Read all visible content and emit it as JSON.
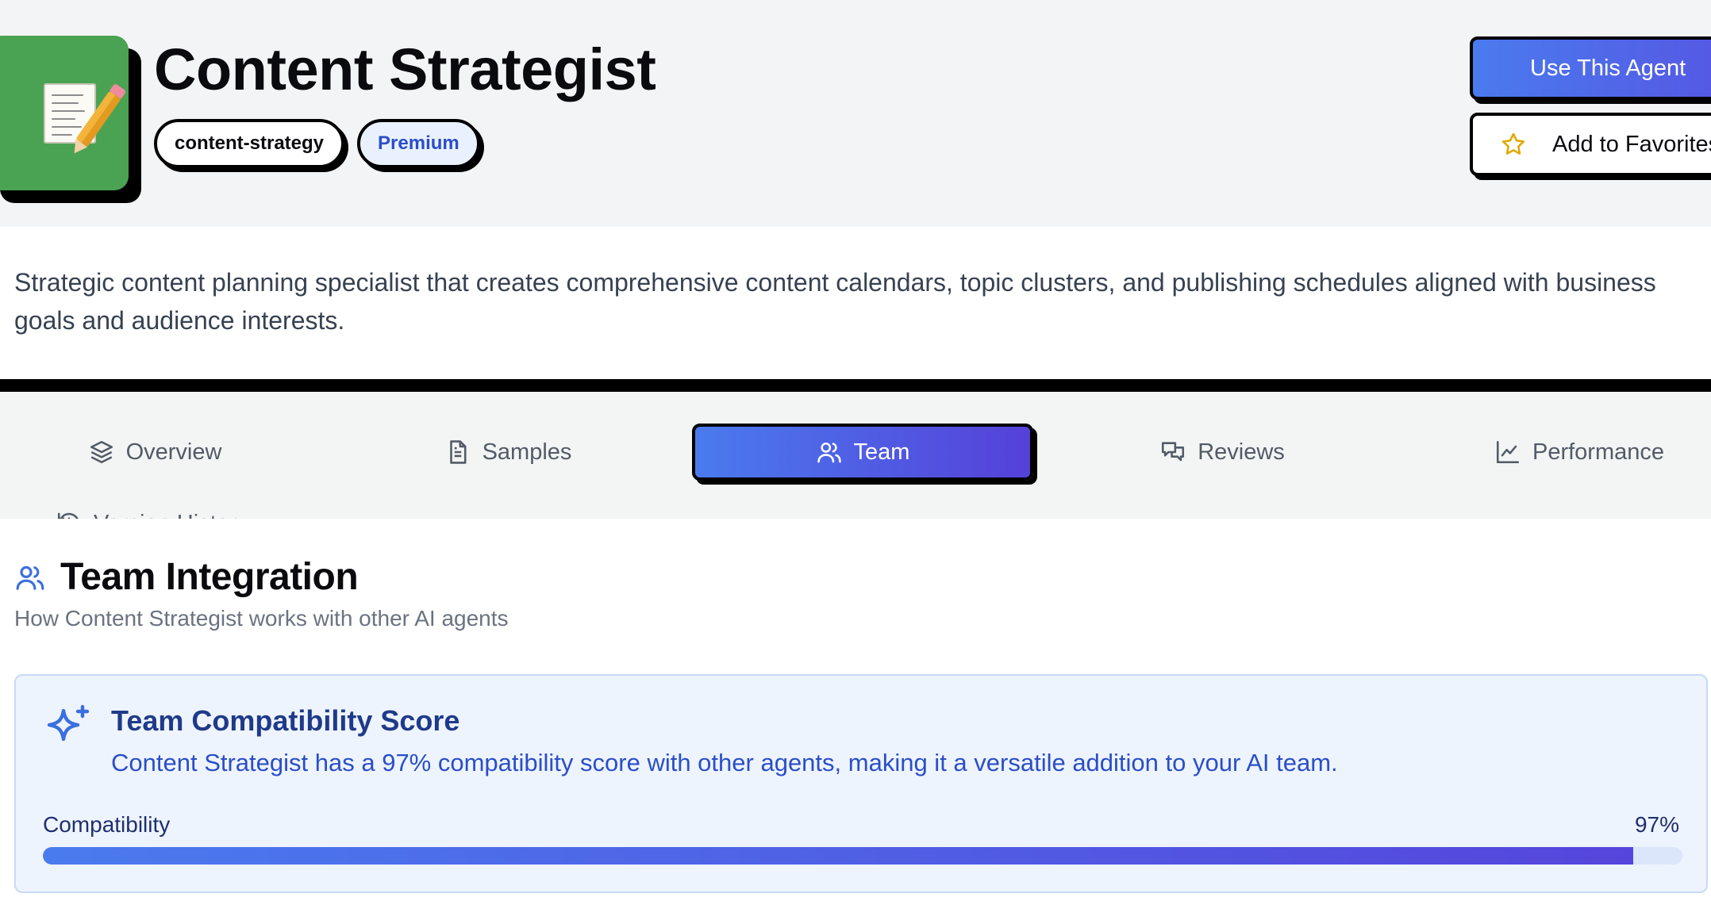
{
  "agent": {
    "title": "Content Strategist",
    "icon": "memo-pencil-icon",
    "icon_bg": "#4aa353",
    "tags": [
      "content-strategy",
      "Premium"
    ],
    "description": "Strategic content planning specialist that creates comprehensive content calendars, topic clusters, and publishing schedules aligned with business goals and audience interests."
  },
  "actions": {
    "use_label": "Use This Agent",
    "favorite_label": "Add to Favorites",
    "favorite_icon": "star-icon"
  },
  "tabs": [
    {
      "label": "Overview",
      "icon": "layers-icon",
      "active": false
    },
    {
      "label": "Samples",
      "icon": "document-icon",
      "active": false
    },
    {
      "label": "Team",
      "icon": "users-icon",
      "active": true
    },
    {
      "label": "Reviews",
      "icon": "chat-bubbles-icon",
      "active": false
    },
    {
      "label": "Performance",
      "icon": "line-chart-icon",
      "active": false
    },
    {
      "label": "Version History",
      "icon": "history-icon",
      "active": false
    }
  ],
  "team": {
    "title": "Team Integration",
    "subtitle": "How Content Strategist works with other AI agents",
    "compatibility": {
      "title": "Team Compatibility Score",
      "text": "Content Strategist has a 97% compatibility score with other agents, making it a versatile addition to your AI team.",
      "label": "Compatibility",
      "value_text": "97%",
      "value": 0.97
    }
  },
  "colors": {
    "accent": "#4a7bee",
    "accent_end": "#5541d9",
    "card_bg": "#eef4fd",
    "premium_text": "#2a4ec9"
  }
}
